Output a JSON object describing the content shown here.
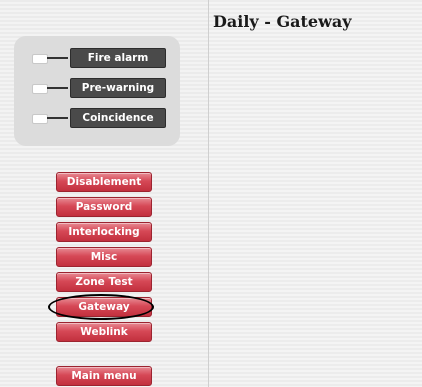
{
  "page": {
    "title": "Daily - Gateway"
  },
  "status_indicators": [
    {
      "label": "Fire alarm"
    },
    {
      "label": "Pre-warning"
    },
    {
      "label": "Coincidence"
    }
  ],
  "menu": {
    "items": [
      {
        "label": "Disablement"
      },
      {
        "label": "Password"
      },
      {
        "label": "Interlocking"
      },
      {
        "label": "Misc"
      },
      {
        "label": "Zone Test"
      },
      {
        "label": "Gateway",
        "selected": true
      },
      {
        "label": "Weblink"
      }
    ],
    "main_menu_label": "Main menu"
  },
  "colors": {
    "button_red": "#d64856",
    "indicator_dark": "#4a4a4a",
    "panel_gray": "#dcdcdc"
  }
}
